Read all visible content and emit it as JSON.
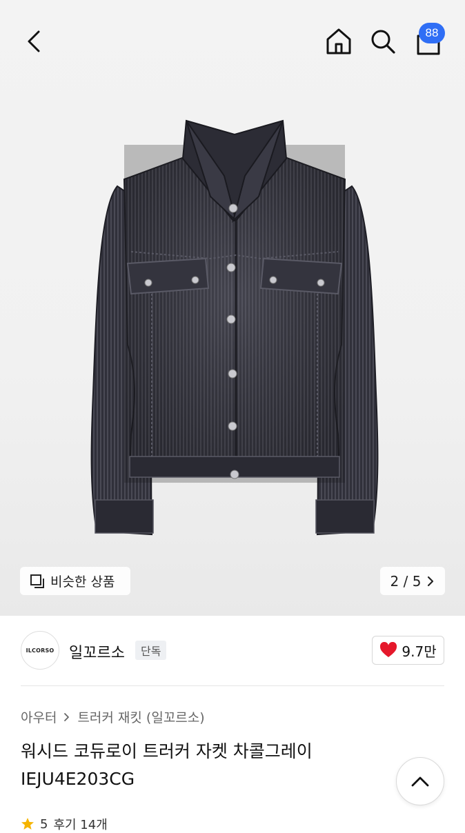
{
  "header": {
    "cart_count": "88"
  },
  "gallery": {
    "similar_label": "비슷한 상품",
    "pager": "2 / 5"
  },
  "brand": {
    "logo_text": "ILCORSO",
    "name": "일꼬르소",
    "tag": "단독",
    "likes": "9.7만"
  },
  "breadcrumb": {
    "category": "아우터",
    "sub": "트러커 재킷 (일꼬르소)"
  },
  "product": {
    "title": "워시드 코듀로이 트러커 자켓 차콜그레이 IEJU4E203CG"
  },
  "reviews": {
    "rating": "5",
    "count_text": "후기 14개"
  },
  "colors": {
    "accent": "#2f6ef5",
    "heart": "#e5182b",
    "star": "#f5b400"
  },
  "icons": [
    "chevron-left-icon",
    "home-icon",
    "search-icon",
    "bag-icon",
    "similar-icon",
    "chevron-right-icon",
    "heart-icon",
    "star-icon",
    "chevron-up-icon"
  ]
}
